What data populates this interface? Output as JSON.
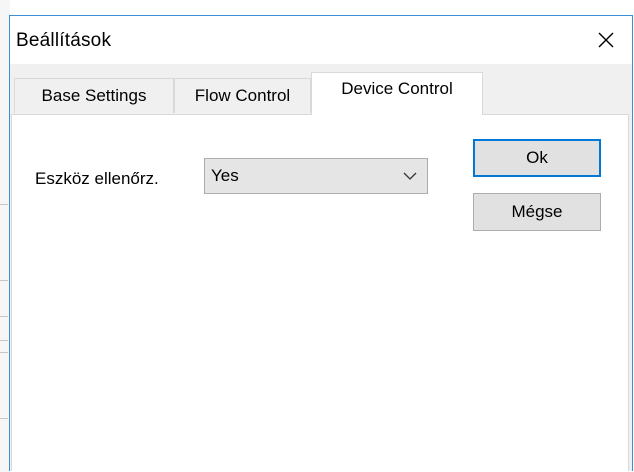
{
  "window": {
    "title": "Beállítások"
  },
  "tabs": [
    {
      "label": "Base Settings",
      "active": false
    },
    {
      "label": "Flow Control",
      "active": false
    },
    {
      "label": "Device Control",
      "active": true
    }
  ],
  "device_control": {
    "label": "Eszköz ellenőrz.",
    "selected_value": "Yes"
  },
  "buttons": {
    "ok": "Ok",
    "cancel": "Mégse"
  },
  "colors": {
    "window_border": "#3b8fd4",
    "default_button_border": "#0078d7",
    "button_face": "#e1e1e1",
    "client_bg": "#f0f0f0"
  },
  "icons": {
    "close": "close-icon",
    "dropdown": "chevron-down-icon"
  }
}
